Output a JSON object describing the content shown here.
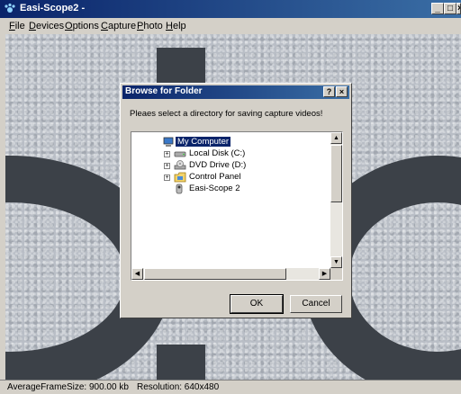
{
  "window": {
    "title": "Easi-Scope2 -",
    "min": "_",
    "max": "□",
    "close": "×"
  },
  "menu": [
    {
      "label": "File"
    },
    {
      "label": "Devices"
    },
    {
      "label": "Options"
    },
    {
      "label": "Capture"
    },
    {
      "label": "Photo"
    },
    {
      "label": "Help"
    }
  ],
  "dialog": {
    "title": "Browse for Folder",
    "help": "?",
    "close": "×",
    "prompt": "Pleaes select a directory for saving capture videos!",
    "tree": [
      {
        "label": "My Computer",
        "icon": "computer-icon",
        "selected": true
      },
      {
        "label": "Local Disk (C:)",
        "icon": "hard-drive-icon",
        "expander": "+"
      },
      {
        "label": "DVD Drive (D:)",
        "icon": "dvd-drive-icon",
        "expander": "+"
      },
      {
        "label": "Control Panel",
        "icon": "control-panel-icon",
        "expander": "+"
      },
      {
        "label": "Easi-Scope 2",
        "icon": "camera-icon"
      }
    ],
    "ok": "OK",
    "cancel": "Cancel"
  },
  "status": {
    "frame_size": "AverageFrameSize: 900.00 kb",
    "resolution": "Resolution: 640x480"
  },
  "colors": {
    "title_active": "#0a246a",
    "selection": "#0a246a",
    "face": "#d4d0c8"
  }
}
